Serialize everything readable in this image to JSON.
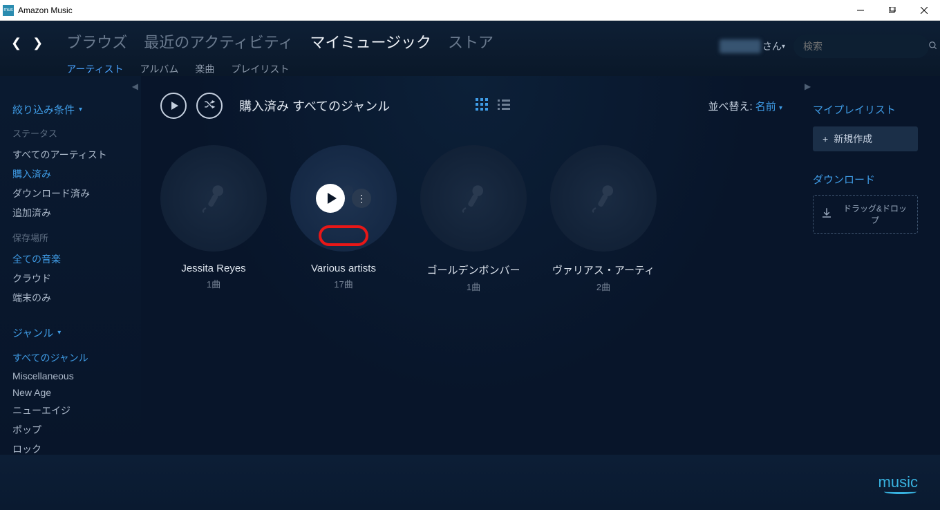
{
  "titlebar": {
    "app_name": "Amazon Music"
  },
  "nav": {
    "main_tabs": [
      "ブラウズ",
      "最近のアクティビティ",
      "マイミュージック",
      "ストア"
    ],
    "active_main_tab": 2,
    "sub_tabs": [
      "アーティスト",
      "アルバム",
      "楽曲",
      "プレイリスト"
    ],
    "active_sub_tab": 0,
    "user_suffix": "さん",
    "search_placeholder": "検索"
  },
  "sidebar": {
    "filter_header": "絞り込み条件",
    "status_label": "ステータス",
    "status_items": [
      "すべてのアーティスト",
      "購入済み",
      "ダウンロード済み",
      "追加済み"
    ],
    "active_status": 1,
    "location_label": "保存場所",
    "location_items": [
      "全ての音楽",
      "クラウド",
      "端末のみ"
    ],
    "active_location": 0,
    "genre_header": "ジャンル",
    "genre_items": [
      "すべてのジャンル",
      "Miscellaneous",
      "New Age",
      "ニューエイジ",
      "ポップ",
      "ロック"
    ],
    "active_genre": 0
  },
  "content": {
    "title": "購入済み すべてのジャンル",
    "sort_label": "並べ替え:",
    "sort_value": "名前",
    "artists": [
      {
        "name": "Jessita Reyes",
        "count": "1曲"
      },
      {
        "name": "Various artists",
        "count": "17曲"
      },
      {
        "name": "ゴールデンボンバー",
        "count": "1曲"
      },
      {
        "name": "ヴァリアス・アーティ",
        "count": "2曲"
      }
    ],
    "hovered_index": 1
  },
  "rightpanel": {
    "playlists_heading": "マイプレイリスト",
    "new_btn": "新規作成",
    "download_heading": "ダウンロード",
    "drop_text": "ドラッグ&ドロップ"
  },
  "footer": {
    "logo_text": "music"
  }
}
